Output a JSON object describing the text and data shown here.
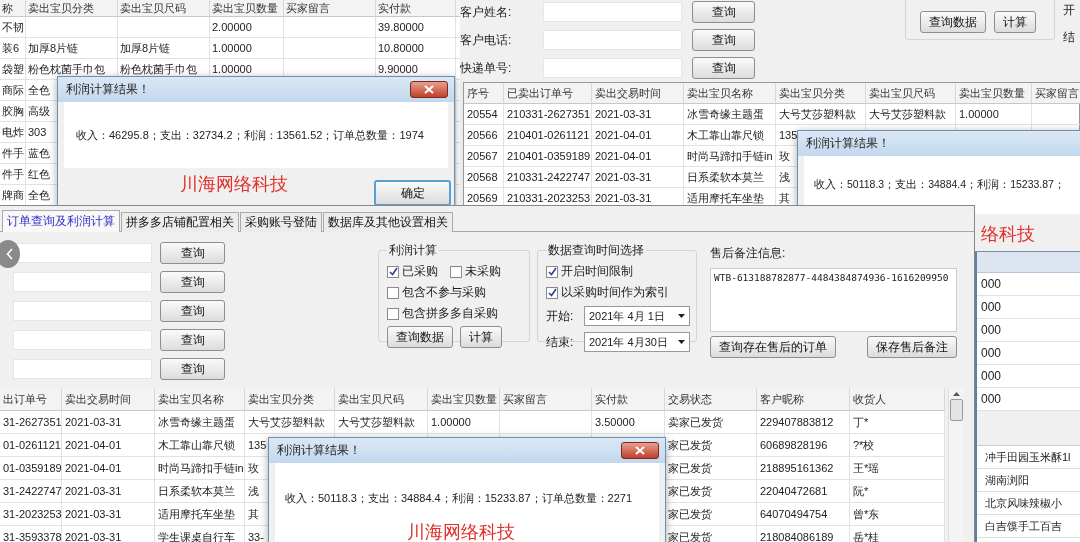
{
  "background_table": {
    "columns": [
      "称",
      "卖出宝贝分类",
      "卖出宝贝尺码",
      "卖出宝贝数量",
      "买家留言",
      "实付款"
    ],
    "rows": [
      {
        "column_1": "不韧",
        "quantity": "2.00000",
        "paid": "39.80000"
      },
      {
        "column_1": "装6",
        "category": "加厚8片链",
        "size": "加厚8片链",
        "quantity": "1.00000",
        "paid": "10.80000"
      },
      {
        "column_1": "袋塑",
        "category": "粉色枕菌手巾包",
        "size": "粉色枕菌手巾包",
        "quantity": "1.00000",
        "paid": "9.90000"
      },
      {
        "column_1": "商际",
        "category": "全色"
      },
      {
        "column_1": "胶胸",
        "category": "高级"
      },
      {
        "column_1": "电炸",
        "category": "303"
      },
      {
        "column_1": "件手",
        "category": "蓝色"
      },
      {
        "column_1": "件手",
        "category": "红色"
      },
      {
        "column_1": "牌商",
        "category": "全色"
      }
    ]
  },
  "search_window": {
    "fields": [
      {
        "label": "客户姓名:",
        "button": "查询"
      },
      {
        "label": "客户电话:",
        "button": "查询"
      },
      {
        "label": "快递单号:",
        "button": "查询"
      }
    ],
    "group_buttons": [
      "查询数据",
      "计算"
    ],
    "cut_labels": [
      "开",
      "结"
    ],
    "table": {
      "columns": [
        "序号",
        "已卖出订单号",
        "卖出交易时间",
        "卖出宝贝名称",
        "卖出宝贝分类",
        "卖出宝贝尺码",
        "卖出宝贝数量",
        "买家留言"
      ],
      "rows": [
        {
          "index": "20554",
          "order_no": "210331-2627351",
          "trade_time": "2021-03-31",
          "item_name": "冰雪奇缘主题蛋",
          "category": "大号艾莎塑料款",
          "size": "大号艾莎塑料款",
          "quantity": "1.00000"
        },
        {
          "index": "20566",
          "order_no": "210401-0261121",
          "trade_time": "2021-04-01",
          "item_name": "木工靠山靠尺锁",
          "category": "135"
        },
        {
          "index": "20567",
          "order_no": "210401-0359189",
          "trade_time": "2021-04-01",
          "item_name": "时尚马蹄扣手链in",
          "category": "玫"
        },
        {
          "index": "20568",
          "order_no": "210331-2422747",
          "trade_time": "2021-03-31",
          "item_name": "日系柔软本莫兰",
          "category": "浅"
        },
        {
          "index": "20569",
          "order_no": "210331-2023253",
          "trade_time": "2021-03-31",
          "item_name": "适用摩托车坐垫",
          "category": "其"
        }
      ]
    }
  },
  "result_dialog_left": {
    "title": "利润计算结果！",
    "message": "收入：46295.8；支出：32734.2；利润：13561.52；订单总数量：1974",
    "brand": "川海网络科技",
    "ok_button": "确定",
    "close_button": true
  },
  "result_dialog_right": {
    "title": "利润计算结果！",
    "message": "收入：50118.3；支出：34884.4；利润：15233.87；",
    "brand": "络科技"
  },
  "right_window": {
    "values": [
      "000",
      "000",
      "000",
      "000",
      "000",
      "000"
    ],
    "rows": [
      "冲手田园玉米酥1l",
      "湖南浏阳",
      "北京风味辣椒小",
      "白吉馍手工百吉"
    ]
  },
  "main_window": {
    "tabs": [
      {
        "label": "订单查询及利润计算",
        "selected": true
      },
      {
        "label": "拼多多店铺配置相关",
        "selected": false
      },
      {
        "label": "采购账号登陆",
        "selected": false
      },
      {
        "label": "数据库及其他设置相关",
        "selected": false
      }
    ],
    "search_buttons": [
      "查询",
      "查询",
      "查询",
      "查询",
      "查询"
    ],
    "profit_group": {
      "title": "利润计算",
      "options": [
        {
          "label": "已采购",
          "checked": true
        },
        {
          "label": "未采购",
          "checked": false
        },
        {
          "label": "包含不参与采购",
          "checked": false
        },
        {
          "label": "包含拼多多自采购",
          "checked": false
        }
      ],
      "buttons": [
        "查询数据",
        "计算"
      ]
    },
    "time_group": {
      "title": "数据查询时间选择",
      "options": [
        {
          "label": "开启时间限制",
          "checked": true
        },
        {
          "label": "以采购时间作为索引",
          "checked": true
        }
      ],
      "start": {
        "label": "开始:",
        "value": "2021年 4月 1日"
      },
      "end": {
        "label": "结束:",
        "value": "2021年 4月30日"
      }
    },
    "after_sale": {
      "label": "售后备注信息:",
      "note": "WTB-613188782877-4484384874936-1616209950",
      "buttons": [
        "查询存在售后的订单",
        "保存售后备注"
      ]
    },
    "table": {
      "columns": [
        "出订单号",
        "卖出交易时间",
        "卖出宝贝名称",
        "卖出宝贝分类",
        "卖出宝贝尺码",
        "卖出宝贝数量",
        "买家留言",
        "实付款",
        "交易状态",
        "客户昵称",
        "收货人"
      ],
      "rows": [
        {
          "order_no": "31-2627351",
          "trade_time": "2021-03-31",
          "item_name": "冰雪奇缘主题蛋",
          "category": "大号艾莎塑料款",
          "size": "大号艾莎塑料款",
          "quantity": "1.00000",
          "paid": "3.50000",
          "status": "卖家已发货",
          "nickname": "229407883812",
          "receiver": "丁*"
        },
        {
          "order_no": "01-0261121",
          "trade_time": "2021-04-01",
          "item_name": "木工靠山靠尺锁",
          "category": "135",
          "status": "家已发货",
          "nickname": "60689828196",
          "receiver": "?*校"
        },
        {
          "order_no": "01-0359189",
          "trade_time": "2021-04-01",
          "item_name": "时尚马蹄扣手链in",
          "category": "玫",
          "status": "家已发货",
          "nickname": "218895161362",
          "receiver": "王*瑶"
        },
        {
          "order_no": "31-2422747",
          "trade_time": "2021-03-31",
          "item_name": "日系柔软本莫兰",
          "category": "浅",
          "status": "家已发货",
          "nickname": "22040472681",
          "receiver": "阮*"
        },
        {
          "order_no": "31-2023253",
          "trade_time": "2021-03-31",
          "item_name": "适用摩托车坐垫",
          "category": "其",
          "status": "家已发货",
          "nickname": "64070494754",
          "receiver": "曾*东"
        },
        {
          "order_no": "31-3593378",
          "trade_time": "2021-03-31",
          "item_name": "学生课桌自行车",
          "category": "33-",
          "status": "家已发货",
          "nickname": "218084086189",
          "receiver": "岳*桂"
        }
      ]
    }
  },
  "result_dialog_bottom": {
    "title": "利润计算结果！",
    "message": "收入：50118.3；支出：34884.4；利润：15233.87；订单总数量：2271",
    "brand": "川海网络科技",
    "close_button": true
  }
}
